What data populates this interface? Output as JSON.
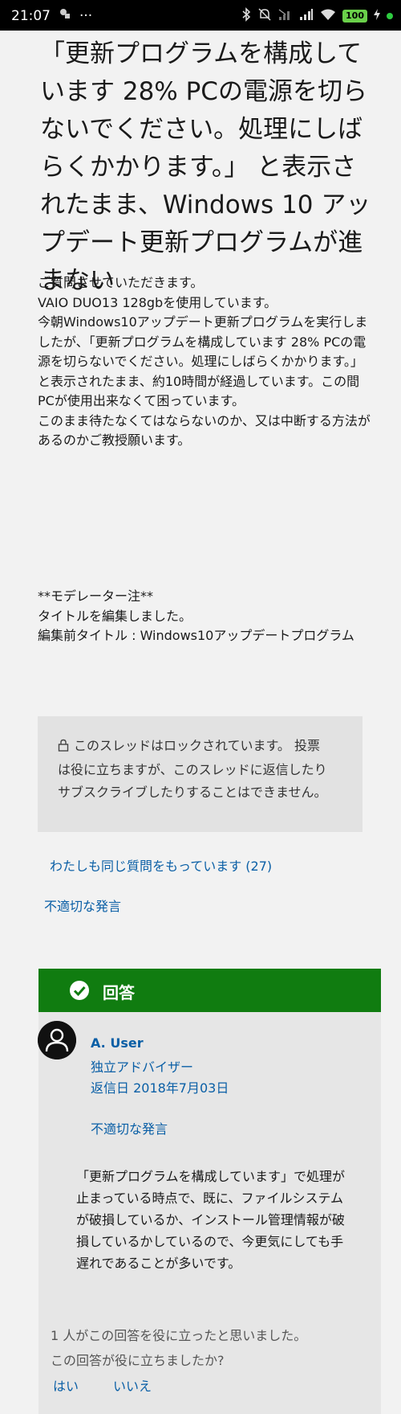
{
  "status_bar": {
    "time": "21:07",
    "more": "···",
    "battery": "100"
  },
  "question": {
    "title": "「更新プログラムを構成しています 28% PCの電源を切らないでください。処理にしばらくかかります。」 と表示されたまま、Windows 10 アップデート更新プログラムが進まない",
    "body": "ご質問させていただきます。\nVAIO DUO13 128gbを使用しています。\n今朝Windows10アップデート更新プログラムを実行しましたが、「更新プログラムを構成しています 28% PCの電源を切らないでください。処理にしばらくかかります。」\nと表示されたまま、約10時間が経過しています。この間PCが使用出来なくて困っています。\nこのまま待たなくてはならないのか、又は中断する方法があるのかご教授願います。",
    "moderator_note": "**モデレーター注**\nタイトルを編集しました。\n編集前タイトル : Windows10アップデートプログラム"
  },
  "lock_notice": "このスレッドはロックされています。 投票は役に立ちますが、このスレッドに返信したりサブスクライブしたりすることはできません。",
  "same_question": "わたしも同じ質問をもっています (27)",
  "report_label": "不適切な発言",
  "answer": {
    "header": "回答",
    "user_name": "A. User",
    "user_role": "独立アドバイザー",
    "reply_date": "返信日 2018年7月03日",
    "report_label": "不適切な発言",
    "text": "「更新プログラムを構成しています」で処理が止まっている時点で、既に、ファイルシステムが破損しているか、インストール管理情報が破損しているかしているので、今更気にしても手遅れであることが多いです。",
    "helpful_count": "1 人がこの回答を役に立ったと思いました。",
    "helpful_question": "この回答が役に立ちましたか?",
    "yes": "はい",
    "no": "いいえ"
  },
  "colors": {
    "accent_green": "#107c10",
    "link_blue": "#0a5fa6",
    "background": "#f2f2f2"
  }
}
